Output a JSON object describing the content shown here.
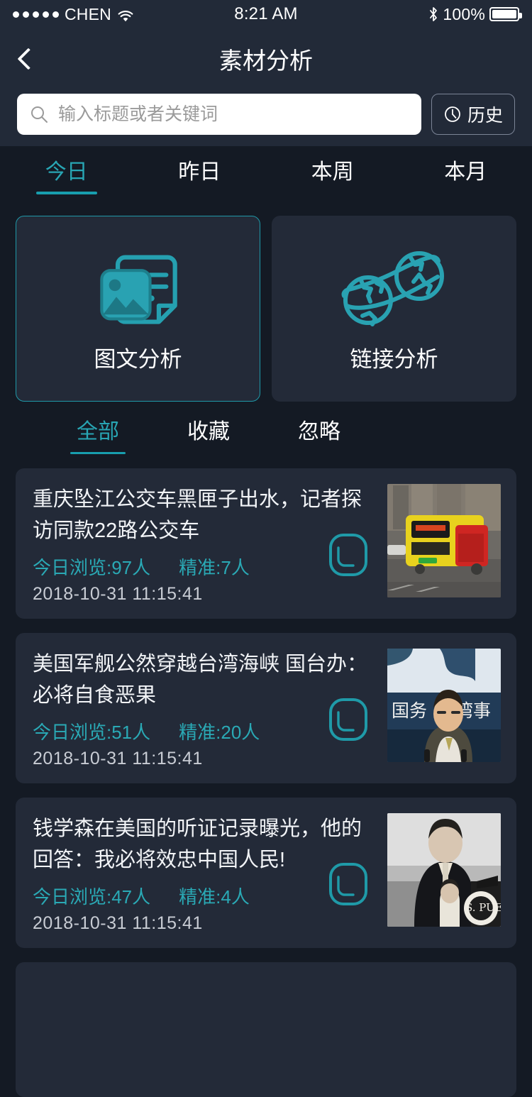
{
  "statusbar": {
    "carrier": "CHEN",
    "time": "8:21 AM",
    "battery_percent": "100%",
    "signal_icon": "signal-dots-icon",
    "wifi_icon": "wifi-icon",
    "bluetooth_icon": "bluetooth-icon",
    "battery_icon": "battery-full-icon"
  },
  "navbar": {
    "title": "素材分析",
    "back_icon": "back-chevron-icon"
  },
  "search": {
    "placeholder": "输入标题或者关键词",
    "value": "",
    "icon": "search-icon",
    "history_label": "历史",
    "history_icon": "clock-icon"
  },
  "period_tabs": {
    "active_index": 0,
    "items": [
      {
        "label": "今日"
      },
      {
        "label": "昨日"
      },
      {
        "label": "本周"
      },
      {
        "label": "本月"
      }
    ]
  },
  "categories": {
    "selected_index": 0,
    "items": [
      {
        "label": "图文分析",
        "icon": "image-document-icon"
      },
      {
        "label": "链接分析",
        "icon": "globes-link-icon"
      }
    ]
  },
  "filter_tabs": {
    "active_index": 0,
    "items": [
      {
        "label": "全部"
      },
      {
        "label": "收藏"
      },
      {
        "label": "忽略"
      }
    ]
  },
  "list": [
    {
      "title": "重庆坠江公交车黑匣子出水，记者探访同款22路公交车",
      "views": "今日浏览:97人",
      "precise": "精准:7人",
      "time": "2018-10-31 11:15:41",
      "action_icon": "bookmark-outline-icon",
      "thumbnail": "yellow-bus-on-street-photo"
    },
    {
      "title": "美国军舰公然穿越台湾海峡 国台办：必将自食恶果",
      "views": "今日浏览:51人",
      "precise": "精准:20人",
      "time": "2018-10-31 11:15:41",
      "action_icon": "bookmark-outline-icon",
      "thumbnail": "spokesman-at-press-conference-photo"
    },
    {
      "title": "钱学森在美国的听证记录曝光，他的回答：我必将效忠中国人民!",
      "views": "今日浏览:47人",
      "precise": "精准:4人",
      "time": "2018-10-31 11:15:41",
      "action_icon": "bookmark-outline-icon",
      "thumbnail": "man-with-child-black-and-white-photo"
    },
    {
      "title": "",
      "views": "",
      "precise": "",
      "time": "",
      "action_icon": "bookmark-outline-icon",
      "thumbnail": ""
    }
  ],
  "colors": {
    "accent": "#189eae",
    "accent_text": "#28a6b4",
    "page_background": "#141a24",
    "header_background": "#222a38",
    "card_background": "#232a38",
    "title_text": "#f2f4f7",
    "time_text": "#c8ccd4"
  }
}
